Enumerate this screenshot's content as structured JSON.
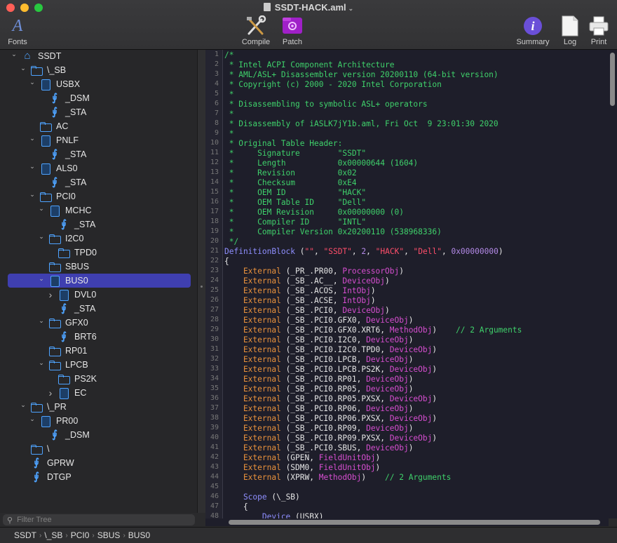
{
  "window": {
    "title": "SSDT-HACK.aml"
  },
  "toolbar": {
    "fonts": "Fonts",
    "compile": "Compile",
    "patch": "Patch",
    "summary": "Summary",
    "log": "Log",
    "print": "Print"
  },
  "colors": {
    "accent": "#3f3fb0",
    "comment": "#3fd16b",
    "keyword": "#8f8fff",
    "external": "#e8913c",
    "string": "#ff4e6a",
    "object": "#d64ed0"
  },
  "tree": [
    {
      "label": "SSDT",
      "icon": "home-icon",
      "level": 0,
      "disclosure": "open"
    },
    {
      "label": "\\_SB",
      "icon": "folder-icon",
      "level": 1,
      "disclosure": "open"
    },
    {
      "label": "USBX",
      "icon": "device-icon",
      "level": 2,
      "disclosure": "open"
    },
    {
      "label": "_DSM",
      "icon": "method-icon",
      "level": 3,
      "disclosure": ""
    },
    {
      "label": "_STA",
      "icon": "method-icon",
      "level": 3,
      "disclosure": ""
    },
    {
      "label": "AC",
      "icon": "folder-icon",
      "level": 2,
      "disclosure": ""
    },
    {
      "label": "PNLF",
      "icon": "device-icon",
      "level": 2,
      "disclosure": "open"
    },
    {
      "label": "_STA",
      "icon": "method-icon",
      "level": 3,
      "disclosure": ""
    },
    {
      "label": "ALS0",
      "icon": "device-icon",
      "level": 2,
      "disclosure": "open"
    },
    {
      "label": "_STA",
      "icon": "method-icon",
      "level": 3,
      "disclosure": ""
    },
    {
      "label": "PCI0",
      "icon": "folder-icon",
      "level": 2,
      "disclosure": "open"
    },
    {
      "label": "MCHC",
      "icon": "device-icon",
      "level": 3,
      "disclosure": "open"
    },
    {
      "label": "_STA",
      "icon": "method-icon",
      "level": 4,
      "disclosure": ""
    },
    {
      "label": "I2C0",
      "icon": "folder-icon",
      "level": 3,
      "disclosure": "open"
    },
    {
      "label": "TPD0",
      "icon": "folder-icon",
      "level": 4,
      "disclosure": ""
    },
    {
      "label": "SBUS",
      "icon": "folder-icon",
      "level": 3,
      "disclosure": ""
    },
    {
      "label": "BUS0",
      "icon": "device-icon",
      "level": 3,
      "disclosure": "open",
      "selected": true
    },
    {
      "label": "DVL0",
      "icon": "device-icon",
      "level": 4,
      "disclosure": "closed"
    },
    {
      "label": "_STA",
      "icon": "method-icon",
      "level": 4,
      "disclosure": ""
    },
    {
      "label": "GFX0",
      "icon": "folder-icon",
      "level": 3,
      "disclosure": "open"
    },
    {
      "label": "BRT6",
      "icon": "method-icon",
      "level": 4,
      "disclosure": ""
    },
    {
      "label": "RP01",
      "icon": "folder-icon",
      "level": 3,
      "disclosure": ""
    },
    {
      "label": "LPCB",
      "icon": "folder-icon",
      "level": 3,
      "disclosure": "open"
    },
    {
      "label": "PS2K",
      "icon": "folder-icon",
      "level": 4,
      "disclosure": ""
    },
    {
      "label": "EC",
      "icon": "device-icon",
      "level": 4,
      "disclosure": "closed"
    },
    {
      "label": "\\_PR",
      "icon": "folder-icon",
      "level": 1,
      "disclosure": "open"
    },
    {
      "label": "PR00",
      "icon": "device-icon",
      "level": 2,
      "disclosure": "open"
    },
    {
      "label": "_DSM",
      "icon": "method-icon",
      "level": 3,
      "disclosure": ""
    },
    {
      "label": "\\",
      "icon": "folder-icon",
      "level": 1,
      "disclosure": ""
    },
    {
      "label": "GPRW",
      "icon": "method-icon",
      "level": 1,
      "disclosure": ""
    },
    {
      "label": "DTGP",
      "icon": "method-icon",
      "level": 1,
      "disclosure": ""
    }
  ],
  "filter": {
    "placeholder": "Filter Tree"
  },
  "pathbar": [
    "SSDT",
    "\\_SB",
    "PCI0",
    "SBUS",
    "BUS0"
  ],
  "code": [
    [
      [
        "c-com",
        "/*"
      ]
    ],
    [
      [
        "c-com",
        " * Intel ACPI Component Architecture"
      ]
    ],
    [
      [
        "c-com",
        " * AML/ASL+ Disassembler version 20200110 (64-bit version)"
      ]
    ],
    [
      [
        "c-com",
        " * Copyright (c) 2000 - 2020 Intel Corporation"
      ]
    ],
    [
      [
        "c-com",
        " *"
      ]
    ],
    [
      [
        "c-com",
        " * Disassembling to symbolic ASL+ operators"
      ]
    ],
    [
      [
        "c-com",
        " *"
      ]
    ],
    [
      [
        "c-com",
        " * Disassembly of iASLK7jY1b.aml, Fri Oct  9 23:01:30 2020"
      ]
    ],
    [
      [
        "c-com",
        " *"
      ]
    ],
    [
      [
        "c-com",
        " * Original Table Header:"
      ]
    ],
    [
      [
        "c-com",
        " *     Signature        \"SSDT\""
      ]
    ],
    [
      [
        "c-com",
        " *     Length           0x00000644 (1604)"
      ]
    ],
    [
      [
        "c-com",
        " *     Revision         0x02"
      ]
    ],
    [
      [
        "c-com",
        " *     Checksum         0xE4"
      ]
    ],
    [
      [
        "c-com",
        " *     OEM ID           \"HACK\""
      ]
    ],
    [
      [
        "c-com",
        " *     OEM Table ID     \"Dell\""
      ]
    ],
    [
      [
        "c-com",
        " *     OEM Revision     0x00000000 (0)"
      ]
    ],
    [
      [
        "c-com",
        " *     Compiler ID      \"INTL\""
      ]
    ],
    [
      [
        "c-com",
        " *     Compiler Version 0x20200110 (538968336)"
      ]
    ],
    [
      [
        "c-com",
        " */"
      ]
    ],
    [
      [
        "c-kw",
        "DefinitionBlock"
      ],
      [
        "c-pun",
        " ("
      ],
      [
        "c-str",
        "\"\""
      ],
      [
        "c-pun",
        ", "
      ],
      [
        "c-str",
        "\"SSDT\""
      ],
      [
        "c-pun",
        ", "
      ],
      [
        "c-num",
        "2"
      ],
      [
        "c-pun",
        ", "
      ],
      [
        "c-str",
        "\"HACK\""
      ],
      [
        "c-pun",
        ", "
      ],
      [
        "c-str",
        "\"Dell\""
      ],
      [
        "c-pun",
        ", "
      ],
      [
        "c-num",
        "0x00000000"
      ],
      [
        "c-pun",
        ")"
      ]
    ],
    [
      [
        "c-pun",
        "{"
      ]
    ],
    [
      [
        "c-ext",
        "    External"
      ],
      [
        "c-id",
        " (_PR_.PR00, "
      ],
      [
        "c-obj",
        "ProcessorObj"
      ],
      [
        "c-id",
        ")"
      ]
    ],
    [
      [
        "c-ext",
        "    External"
      ],
      [
        "c-id",
        " (_SB_.AC__, "
      ],
      [
        "c-obj",
        "DeviceObj"
      ],
      [
        "c-id",
        ")"
      ]
    ],
    [
      [
        "c-ext",
        "    External"
      ],
      [
        "c-id",
        " (_SB_.ACOS, "
      ],
      [
        "c-obj",
        "IntObj"
      ],
      [
        "c-id",
        ")"
      ]
    ],
    [
      [
        "c-ext",
        "    External"
      ],
      [
        "c-id",
        " (_SB_.ACSE, "
      ],
      [
        "c-obj",
        "IntObj"
      ],
      [
        "c-id",
        ")"
      ]
    ],
    [
      [
        "c-ext",
        "    External"
      ],
      [
        "c-id",
        " (_SB_.PCI0, "
      ],
      [
        "c-obj",
        "DeviceObj"
      ],
      [
        "c-id",
        ")"
      ]
    ],
    [
      [
        "c-ext",
        "    External"
      ],
      [
        "c-id",
        " (_SB_.PCI0.GFX0, "
      ],
      [
        "c-obj",
        "DeviceObj"
      ],
      [
        "c-id",
        ")"
      ]
    ],
    [
      [
        "c-ext",
        "    External"
      ],
      [
        "c-id",
        " (_SB_.PCI0.GFX0.XRT6, "
      ],
      [
        "c-obj",
        "MethodObj"
      ],
      [
        "c-id",
        ")    "
      ],
      [
        "c-com",
        "// 2 Arguments"
      ]
    ],
    [
      [
        "c-ext",
        "    External"
      ],
      [
        "c-id",
        " (_SB_.PCI0.I2C0, "
      ],
      [
        "c-obj",
        "DeviceObj"
      ],
      [
        "c-id",
        ")"
      ]
    ],
    [
      [
        "c-ext",
        "    External"
      ],
      [
        "c-id",
        " (_SB_.PCI0.I2C0.TPD0, "
      ],
      [
        "c-obj",
        "DeviceObj"
      ],
      [
        "c-id",
        ")"
      ]
    ],
    [
      [
        "c-ext",
        "    External"
      ],
      [
        "c-id",
        " (_SB_.PCI0.LPCB, "
      ],
      [
        "c-obj",
        "DeviceObj"
      ],
      [
        "c-id",
        ")"
      ]
    ],
    [
      [
        "c-ext",
        "    External"
      ],
      [
        "c-id",
        " (_SB_.PCI0.LPCB.PS2K, "
      ],
      [
        "c-obj",
        "DeviceObj"
      ],
      [
        "c-id",
        ")"
      ]
    ],
    [
      [
        "c-ext",
        "    External"
      ],
      [
        "c-id",
        " (_SB_.PCI0.RP01, "
      ],
      [
        "c-obj",
        "DeviceObj"
      ],
      [
        "c-id",
        ")"
      ]
    ],
    [
      [
        "c-ext",
        "    External"
      ],
      [
        "c-id",
        " (_SB_.PCI0.RP05, "
      ],
      [
        "c-obj",
        "DeviceObj"
      ],
      [
        "c-id",
        ")"
      ]
    ],
    [
      [
        "c-ext",
        "    External"
      ],
      [
        "c-id",
        " (_SB_.PCI0.RP05.PXSX, "
      ],
      [
        "c-obj",
        "DeviceObj"
      ],
      [
        "c-id",
        ")"
      ]
    ],
    [
      [
        "c-ext",
        "    External"
      ],
      [
        "c-id",
        " (_SB_.PCI0.RP06, "
      ],
      [
        "c-obj",
        "DeviceObj"
      ],
      [
        "c-id",
        ")"
      ]
    ],
    [
      [
        "c-ext",
        "    External"
      ],
      [
        "c-id",
        " (_SB_.PCI0.RP06.PXSX, "
      ],
      [
        "c-obj",
        "DeviceObj"
      ],
      [
        "c-id",
        ")"
      ]
    ],
    [
      [
        "c-ext",
        "    External"
      ],
      [
        "c-id",
        " (_SB_.PCI0.RP09, "
      ],
      [
        "c-obj",
        "DeviceObj"
      ],
      [
        "c-id",
        ")"
      ]
    ],
    [
      [
        "c-ext",
        "    External"
      ],
      [
        "c-id",
        " (_SB_.PCI0.RP09.PXSX, "
      ],
      [
        "c-obj",
        "DeviceObj"
      ],
      [
        "c-id",
        ")"
      ]
    ],
    [
      [
        "c-ext",
        "    External"
      ],
      [
        "c-id",
        " (_SB_.PCI0.SBUS, "
      ],
      [
        "c-obj",
        "DeviceObj"
      ],
      [
        "c-id",
        ")"
      ]
    ],
    [
      [
        "c-ext",
        "    External"
      ],
      [
        "c-id",
        " (GPEN, "
      ],
      [
        "c-obj",
        "FieldUnitObj"
      ],
      [
        "c-id",
        ")"
      ]
    ],
    [
      [
        "c-ext",
        "    External"
      ],
      [
        "c-id",
        " (SDM0, "
      ],
      [
        "c-obj",
        "FieldUnitObj"
      ],
      [
        "c-id",
        ")"
      ]
    ],
    [
      [
        "c-ext",
        "    External"
      ],
      [
        "c-id",
        " (XPRW, "
      ],
      [
        "c-obj",
        "MethodObj"
      ],
      [
        "c-id",
        ")    "
      ],
      [
        "c-com",
        "// 2 Arguments"
      ]
    ],
    [
      [
        "c-id",
        ""
      ]
    ],
    [
      [
        "c-kw",
        "    Scope"
      ],
      [
        "c-id",
        " (\\_SB)"
      ]
    ],
    [
      [
        "c-id",
        "    {"
      ]
    ],
    [
      [
        "c-kw",
        "        Device"
      ],
      [
        "c-id",
        " (USBX)"
      ]
    ],
    [
      [
        "c-id",
        ""
      ]
    ]
  ]
}
